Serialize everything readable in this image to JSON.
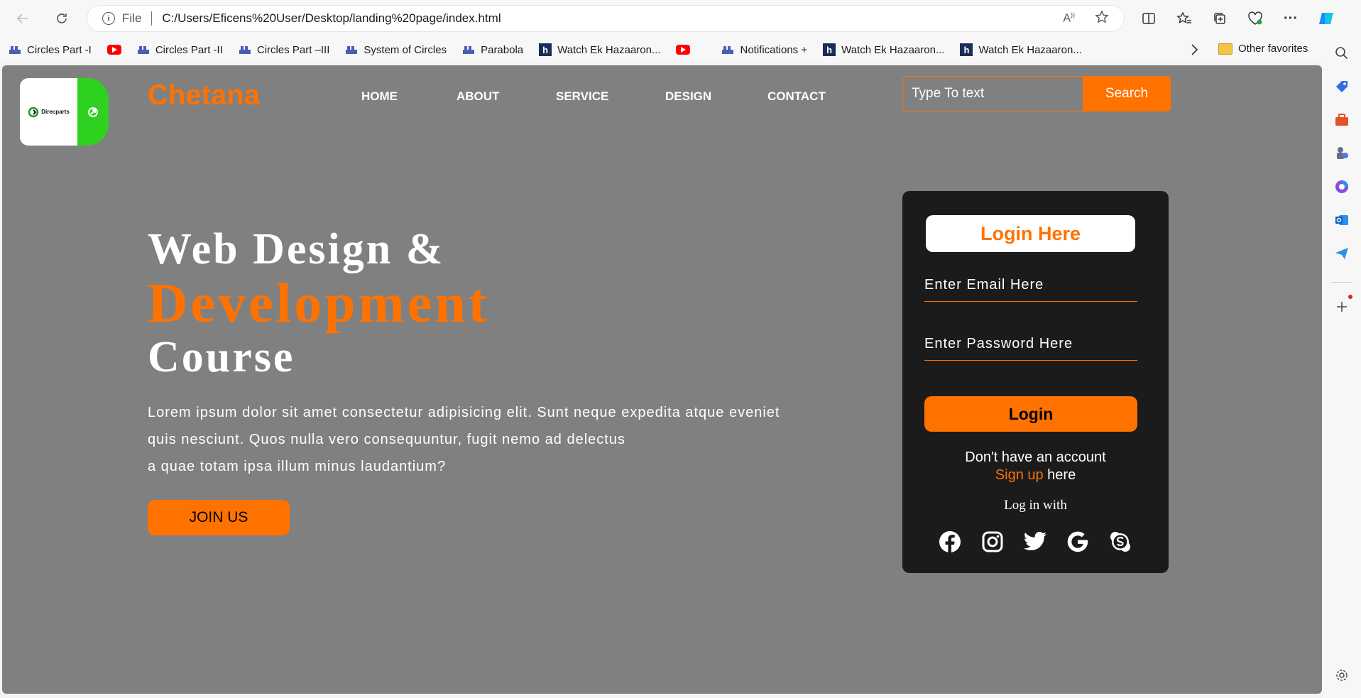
{
  "browser": {
    "file_label": "File",
    "url": "C:/Users/Eficens%20User/Desktop/landing%20page/index.html"
  },
  "favorites": [
    {
      "label": "Circles Part -I",
      "icon": "stack-icon"
    },
    {
      "label": "",
      "icon": "youtube-icon"
    },
    {
      "label": "Circles Part -II",
      "icon": "stack-icon"
    },
    {
      "label": "Circles Part –III",
      "icon": "stack-icon"
    },
    {
      "label": "System of Circles",
      "icon": "stack-icon"
    },
    {
      "label": "Parabola",
      "icon": "stack-icon"
    },
    {
      "label": "Watch Ek Hazaaron...",
      "icon": "h-icon"
    },
    {
      "label": "",
      "icon": "youtube-icon"
    },
    {
      "label": "Notifications +",
      "icon": "stack-icon"
    },
    {
      "label": "Watch Ek Hazaaron...",
      "icon": "h-icon"
    },
    {
      "label": "Watch Ek Hazaaron...",
      "icon": "h-icon"
    }
  ],
  "other_favorites": "Other favorites",
  "site": {
    "logo_text": "Direcparts",
    "brand": "Chetana",
    "nav": [
      "HOME",
      "ABOUT",
      "SERVICE",
      "DESIGN",
      "CONTACT"
    ],
    "search_placeholder": "Type To text",
    "search_button": "Search"
  },
  "hero": {
    "line1": "Web Design &",
    "line2": "Development",
    "line3": "Course",
    "para1": "Lorem ipsum dolor sit amet consectetur adipisicing elit. Sunt neque expedita atque eveniet",
    "para2": "quis nesciunt. Quos nulla vero consequuntur, fugit nemo ad delectus",
    "para3": "a quae totam ipsa illum minus laudantium?",
    "cta": "JOIN US"
  },
  "login": {
    "title": "Login Here",
    "email_placeholder": "Enter Email Here",
    "password_placeholder": "Enter Password Here",
    "button": "Login",
    "no_account": "Don't have an account",
    "signup_link": "Sign up",
    "signup_suffix": " here",
    "log_with": "Log in with",
    "socials": [
      "facebook-icon",
      "instagram-icon",
      "twitter-icon",
      "google-icon",
      "skype-icon"
    ]
  },
  "colors": {
    "accent": "#ff7200",
    "page_bg": "#808080",
    "card_bg": "#1b1b1b"
  }
}
